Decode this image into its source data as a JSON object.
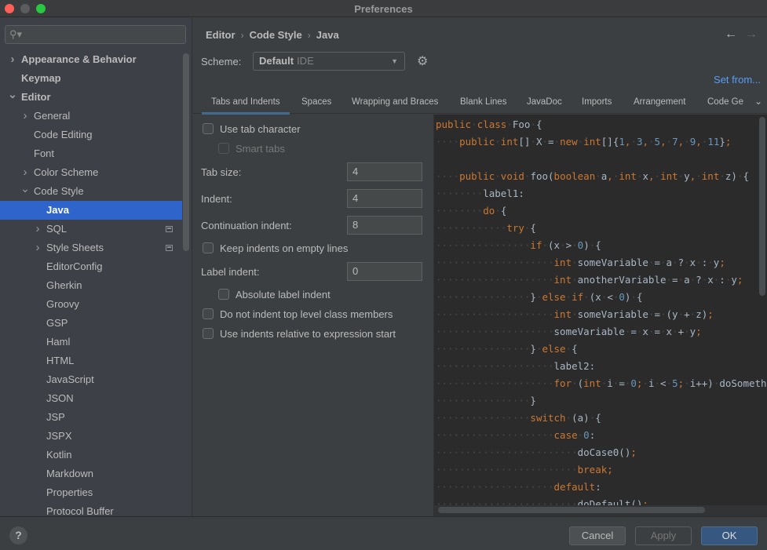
{
  "window": {
    "title": "Preferences"
  },
  "sidebar": {
    "search_placeholder": "",
    "search_icon": "search-icon",
    "items": [
      {
        "label": "Appearance & Behavior",
        "level": 0,
        "expandable": true,
        "expanded": false,
        "bold": true
      },
      {
        "label": "Keymap",
        "level": 0,
        "expandable": false,
        "bold": true
      },
      {
        "label": "Editor",
        "level": 0,
        "expandable": true,
        "expanded": true,
        "bold": true
      },
      {
        "label": "General",
        "level": 1,
        "expandable": true,
        "expanded": false
      },
      {
        "label": "Code Editing",
        "level": 1,
        "expandable": false
      },
      {
        "label": "Font",
        "level": 1,
        "expandable": false
      },
      {
        "label": "Color Scheme",
        "level": 1,
        "expandable": true,
        "expanded": false
      },
      {
        "label": "Code Style",
        "level": 1,
        "expandable": true,
        "expanded": true
      },
      {
        "label": "Java",
        "level": 2,
        "expandable": false,
        "selected": true
      },
      {
        "label": "SQL",
        "level": 2,
        "expandable": true,
        "expanded": false,
        "badge": true
      },
      {
        "label": "Style Sheets",
        "level": 2,
        "expandable": true,
        "expanded": false,
        "badge": true
      },
      {
        "label": "EditorConfig",
        "level": 2,
        "expandable": false
      },
      {
        "label": "Gherkin",
        "level": 2,
        "expandable": false
      },
      {
        "label": "Groovy",
        "level": 2,
        "expandable": false
      },
      {
        "label": "GSP",
        "level": 2,
        "expandable": false
      },
      {
        "label": "Haml",
        "level": 2,
        "expandable": false
      },
      {
        "label": "HTML",
        "level": 2,
        "expandable": false
      },
      {
        "label": "JavaScript",
        "level": 2,
        "expandable": false
      },
      {
        "label": "JSON",
        "level": 2,
        "expandable": false
      },
      {
        "label": "JSP",
        "level": 2,
        "expandable": false
      },
      {
        "label": "JSPX",
        "level": 2,
        "expandable": false
      },
      {
        "label": "Kotlin",
        "level": 2,
        "expandable": false
      },
      {
        "label": "Markdown",
        "level": 2,
        "expandable": false
      },
      {
        "label": "Properties",
        "level": 2,
        "expandable": false
      },
      {
        "label": "Protocol Buffer",
        "level": 2,
        "expandable": false
      }
    ]
  },
  "breadcrumb": [
    "Editor",
    "Code Style",
    "Java"
  ],
  "nav": {
    "back": "←",
    "forward": "→"
  },
  "scheme": {
    "label": "Scheme:",
    "name": "Default",
    "sub": "IDE",
    "set_from": "Set from..."
  },
  "tabs": [
    {
      "label": "Tabs and Indents",
      "active": true
    },
    {
      "label": "Spaces"
    },
    {
      "label": "Wrapping and Braces"
    },
    {
      "label": "Blank Lines"
    },
    {
      "label": "JavaDoc"
    },
    {
      "label": "Imports"
    },
    {
      "label": "Arrangement"
    },
    {
      "label": "Code Ge"
    }
  ],
  "settings": {
    "use_tab_character": {
      "label": "Use tab character",
      "checked": false
    },
    "smart_tabs": {
      "label": "Smart tabs",
      "checked": false,
      "disabled": true
    },
    "tab_size": {
      "label": "Tab size:",
      "value": "4"
    },
    "indent": {
      "label": "Indent:",
      "value": "4"
    },
    "continuation_indent": {
      "label": "Continuation indent:",
      "value": "8"
    },
    "keep_indents_empty": {
      "label": "Keep indents on empty lines",
      "checked": false
    },
    "label_indent": {
      "label": "Label indent:",
      "value": "0"
    },
    "absolute_label_indent": {
      "label": "Absolute label indent",
      "checked": false
    },
    "no_indent_top_level": {
      "label": "Do not indent top level class members",
      "checked": false
    },
    "indents_relative_expr": {
      "label": "Use indents relative to expression start",
      "checked": false
    }
  },
  "preview": {
    "lines": [
      {
        "indent": 0,
        "tokens": [
          [
            "k",
            "public"
          ],
          [
            " "
          ],
          [
            "k",
            "class"
          ],
          [
            " "
          ],
          [
            "t",
            "Foo"
          ],
          [
            " "
          ],
          [
            "t",
            "{"
          ]
        ]
      },
      {
        "indent": 1,
        "tokens": [
          [
            "k",
            "public"
          ],
          [
            " "
          ],
          [
            "k",
            "int"
          ],
          [
            "t",
            "[]"
          ],
          [
            " "
          ],
          [
            "t",
            "X"
          ],
          [
            " "
          ],
          [
            "t",
            "="
          ],
          [
            " "
          ],
          [
            "k",
            "new"
          ],
          [
            " "
          ],
          [
            "k",
            "int"
          ],
          [
            "t",
            "[]{"
          ],
          [
            "n",
            "1"
          ],
          [
            "k",
            ","
          ],
          [
            " "
          ],
          [
            "n",
            "3"
          ],
          [
            "k",
            ","
          ],
          [
            " "
          ],
          [
            "n",
            "5"
          ],
          [
            "k",
            ","
          ],
          [
            " "
          ],
          [
            "n",
            "7"
          ],
          [
            "k",
            ","
          ],
          [
            " "
          ],
          [
            "n",
            "9"
          ],
          [
            "k",
            ","
          ],
          [
            " "
          ],
          [
            "n",
            "11"
          ],
          [
            "t",
            "}"
          ],
          [
            "k",
            ";"
          ]
        ]
      },
      {
        "indent": 0,
        "tokens": []
      },
      {
        "indent": 1,
        "tokens": [
          [
            "k",
            "public"
          ],
          [
            " "
          ],
          [
            "k",
            "void"
          ],
          [
            " "
          ],
          [
            "t",
            "foo("
          ],
          [
            "k",
            "boolean"
          ],
          [
            " "
          ],
          [
            "t",
            "a"
          ],
          [
            "k",
            ","
          ],
          [
            " "
          ],
          [
            "k",
            "int"
          ],
          [
            " "
          ],
          [
            "t",
            "x"
          ],
          [
            "k",
            ","
          ],
          [
            " "
          ],
          [
            "k",
            "int"
          ],
          [
            " "
          ],
          [
            "t",
            "y"
          ],
          [
            "k",
            ","
          ],
          [
            " "
          ],
          [
            "k",
            "int"
          ],
          [
            " "
          ],
          [
            "t",
            "z)"
          ],
          [
            " "
          ],
          [
            "t",
            "{"
          ]
        ]
      },
      {
        "indent": 2,
        "tokens": [
          [
            "t",
            "label1:"
          ]
        ]
      },
      {
        "indent": 2,
        "tokens": [
          [
            "k",
            "do"
          ],
          [
            " "
          ],
          [
            "t",
            "{"
          ]
        ]
      },
      {
        "indent": 3,
        "tokens": [
          [
            "k",
            "try"
          ],
          [
            " "
          ],
          [
            "t",
            "{"
          ]
        ]
      },
      {
        "indent": 4,
        "tokens": [
          [
            "k",
            "if"
          ],
          [
            " "
          ],
          [
            "t",
            "(x"
          ],
          [
            " "
          ],
          [
            "t",
            ">"
          ],
          [
            " "
          ],
          [
            "n",
            "0"
          ],
          [
            "t",
            ")"
          ],
          [
            " "
          ],
          [
            "t",
            "{"
          ]
        ]
      },
      {
        "indent": 5,
        "tokens": [
          [
            "k",
            "int"
          ],
          [
            " "
          ],
          [
            "t",
            "someVariable"
          ],
          [
            " "
          ],
          [
            "t",
            "="
          ],
          [
            " "
          ],
          [
            "t",
            "a"
          ],
          [
            " "
          ],
          [
            "t",
            "?"
          ],
          [
            " "
          ],
          [
            "t",
            "x"
          ],
          [
            " "
          ],
          [
            "t",
            ":"
          ],
          [
            " "
          ],
          [
            "t",
            "y"
          ],
          [
            "k",
            ";"
          ]
        ]
      },
      {
        "indent": 5,
        "tokens": [
          [
            "k",
            "int"
          ],
          [
            " "
          ],
          [
            "t",
            "anotherVariable"
          ],
          [
            " "
          ],
          [
            "t",
            "="
          ],
          [
            " "
          ],
          [
            "t",
            "a"
          ],
          [
            " "
          ],
          [
            "t",
            "?"
          ],
          [
            " "
          ],
          [
            "t",
            "x"
          ],
          [
            " "
          ],
          [
            "t",
            ":"
          ],
          [
            " "
          ],
          [
            "t",
            "y"
          ],
          [
            "k",
            ";"
          ]
        ]
      },
      {
        "indent": 4,
        "tokens": [
          [
            "t",
            "}"
          ],
          [
            " "
          ],
          [
            "k",
            "else"
          ],
          [
            " "
          ],
          [
            "k",
            "if"
          ],
          [
            " "
          ],
          [
            "t",
            "(x"
          ],
          [
            " "
          ],
          [
            "t",
            "<"
          ],
          [
            " "
          ],
          [
            "n",
            "0"
          ],
          [
            "t",
            ")"
          ],
          [
            " "
          ],
          [
            "t",
            "{"
          ]
        ]
      },
      {
        "indent": 5,
        "tokens": [
          [
            "k",
            "int"
          ],
          [
            " "
          ],
          [
            "t",
            "someVariable"
          ],
          [
            " "
          ],
          [
            "t",
            "="
          ],
          [
            " "
          ],
          [
            "t",
            "(y"
          ],
          [
            " "
          ],
          [
            "t",
            "+"
          ],
          [
            " "
          ],
          [
            "t",
            "z)"
          ],
          [
            "k",
            ";"
          ]
        ]
      },
      {
        "indent": 5,
        "tokens": [
          [
            "t",
            "someVariable"
          ],
          [
            " "
          ],
          [
            "t",
            "="
          ],
          [
            " "
          ],
          [
            "t",
            "x"
          ],
          [
            " "
          ],
          [
            "t",
            "="
          ],
          [
            " "
          ],
          [
            "t",
            "x"
          ],
          [
            " "
          ],
          [
            "t",
            "+"
          ],
          [
            " "
          ],
          [
            "t",
            "y"
          ],
          [
            "k",
            ";"
          ]
        ]
      },
      {
        "indent": 4,
        "tokens": [
          [
            "t",
            "}"
          ],
          [
            " "
          ],
          [
            "k",
            "else"
          ],
          [
            " "
          ],
          [
            "t",
            "{"
          ]
        ]
      },
      {
        "indent": 5,
        "tokens": [
          [
            "t",
            "label2:"
          ]
        ]
      },
      {
        "indent": 5,
        "tokens": [
          [
            "k",
            "for"
          ],
          [
            " "
          ],
          [
            "t",
            "("
          ],
          [
            "k",
            "int"
          ],
          [
            " "
          ],
          [
            "t",
            "i"
          ],
          [
            " "
          ],
          [
            "t",
            "="
          ],
          [
            " "
          ],
          [
            "n",
            "0"
          ],
          [
            "k",
            ";"
          ],
          [
            " "
          ],
          [
            "t",
            "i"
          ],
          [
            " "
          ],
          [
            "t",
            "<"
          ],
          [
            " "
          ],
          [
            "n",
            "5"
          ],
          [
            "k",
            ";"
          ],
          [
            " "
          ],
          [
            "t",
            "i++)"
          ],
          [
            " "
          ],
          [
            "t",
            "doSomething(i)"
          ],
          [
            "k",
            ";"
          ]
        ]
      },
      {
        "indent": 4,
        "tokens": [
          [
            "t",
            "}"
          ]
        ]
      },
      {
        "indent": 4,
        "tokens": [
          [
            "k",
            "switch"
          ],
          [
            " "
          ],
          [
            "t",
            "(a)"
          ],
          [
            " "
          ],
          [
            "t",
            "{"
          ]
        ]
      },
      {
        "indent": 5,
        "tokens": [
          [
            "k",
            "case"
          ],
          [
            " "
          ],
          [
            "n",
            "0"
          ],
          [
            "t",
            ":"
          ]
        ]
      },
      {
        "indent": 6,
        "tokens": [
          [
            "t",
            "doCase0()"
          ],
          [
            "k",
            ";"
          ]
        ]
      },
      {
        "indent": 6,
        "tokens": [
          [
            "k",
            "break"
          ],
          [
            "k",
            ";"
          ]
        ]
      },
      {
        "indent": 5,
        "tokens": [
          [
            "k",
            "default"
          ],
          [
            "t",
            ":"
          ]
        ]
      },
      {
        "indent": 6,
        "tokens": [
          [
            "t",
            "doDefault()"
          ],
          [
            "k",
            ";"
          ]
        ]
      }
    ]
  },
  "footer": {
    "help": "?",
    "cancel": "Cancel",
    "apply": "Apply",
    "ok": "OK"
  }
}
